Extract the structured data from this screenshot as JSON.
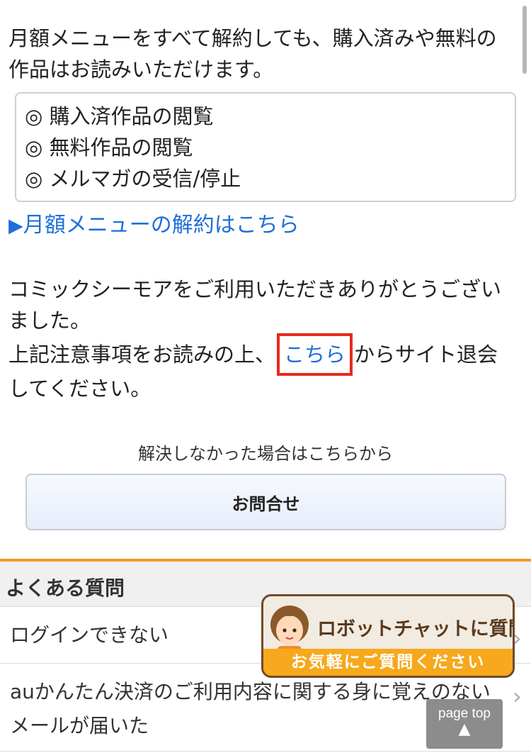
{
  "intro": {
    "text": "月額メニューをすべて解約しても、購入済みや無料の作品はお読みいただけます。"
  },
  "features": {
    "items": [
      "◎ 購入済作品の閲覧",
      "◎ 無料作品の閲覧",
      "◎ メルマガの受信/停止"
    ]
  },
  "cancel_link": {
    "marker": "▶",
    "label": "月額メニューの解約はこちら"
  },
  "thanks": {
    "line1": "コミックシーモアをご利用いただきありがとうございました。",
    "before_link": "上記注意事項をお読みの上、",
    "link": "こちら",
    "after_link": "からサイト退会してください。"
  },
  "support": {
    "prompt": "解決しなかった場合はこちらから",
    "button": "お問合せ"
  },
  "faq": {
    "title": "よくある質問",
    "items": [
      "ログインできない",
      "auかんたん決済のご利用内容に関する身に覚えのないメールが届いた"
    ]
  },
  "robot_chat": {
    "title": "ロボットチャットに質問",
    "subtitle": "お気軽にご質問ください"
  },
  "page_top": {
    "label": "page top",
    "arrow": "▲"
  },
  "colors": {
    "link": "#1f6fd8",
    "highlight_border": "#e8281d",
    "faq_accent": "#f39a26",
    "chat_banner": "#f7a81c"
  }
}
